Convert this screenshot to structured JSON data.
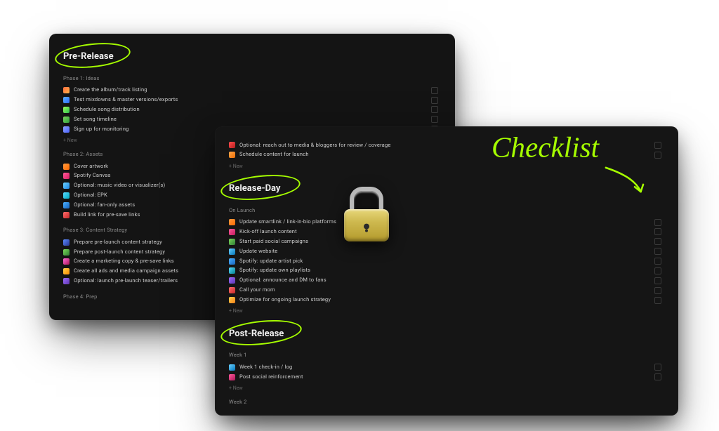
{
  "annotations": {
    "script_label": "Checklist"
  },
  "card_a": {
    "sections": [
      {
        "title": "Pre-Release",
        "subhead": "Phase 1: Ideas",
        "items": [
          {
            "icon": [
              "#ff6b3d",
              "#ffb347"
            ],
            "label": "Create the album/track listing"
          },
          {
            "icon": [
              "#5ab0ff",
              "#2d6bff"
            ],
            "label": "Test mixdowns & master versions/exports"
          },
          {
            "icon": [
              "#9bff5a",
              "#2dbf4e"
            ],
            "label": "Schedule song distribution"
          },
          {
            "icon": [
              "#7bd85a",
              "#2f9e3f"
            ],
            "label": "Set song timeline"
          },
          {
            "icon": [
              "#8fa2ff",
              "#4b63ff"
            ],
            "label": "Sign up for monitoring"
          }
        ],
        "new_label": "+ New"
      },
      {
        "subhead": "Phase 2: Assets",
        "items": [
          {
            "icon": [
              "#ff9a3d",
              "#ff6a00"
            ],
            "label": "Cover artwork"
          },
          {
            "icon": [
              "#ff5a9b",
              "#d81b60"
            ],
            "label": "Spotify Canvas"
          },
          {
            "icon": [
              "#6bd1ff",
              "#1e88e5"
            ],
            "label": "Optional: music video or visualizer(s)"
          },
          {
            "icon": [
              "#5ad8ff",
              "#00acc1"
            ],
            "label": "Optional: EPK"
          },
          {
            "icon": [
              "#4ab0ff",
              "#1565c0"
            ],
            "label": "Optional: fan-only assets"
          },
          {
            "icon": [
              "#ff6b6b",
              "#c62828"
            ],
            "label": "Build link for pre-save links"
          }
        ]
      },
      {
        "subhead": "Phase 3: Content Strategy",
        "items": [
          {
            "icon": [
              "#5a8bff",
              "#283593"
            ],
            "label": "Prepare pre-launch content strategy"
          },
          {
            "icon": [
              "#7bd85a",
              "#2e7d32"
            ],
            "label": "Prepare post-launch content strategy"
          },
          {
            "icon": [
              "#ff6bd8",
              "#ad1457"
            ],
            "label": "Create a marketing copy & pre-save links"
          },
          {
            "icon": [
              "#ffd24a",
              "#fb8c00"
            ],
            "label": "Create all ads and media campaign assets"
          },
          {
            "icon": [
              "#9b6bff",
              "#5e35b1"
            ],
            "label": "Optional: launch pre-launch teaser/trailers"
          }
        ]
      },
      {
        "subhead": "Phase 4: Prep",
        "items": []
      }
    ]
  },
  "card_b": {
    "top_items": [
      {
        "icon": [
          "#ff4d4d",
          "#b71c1c"
        ],
        "label": "Optional: reach out to media & bloggers for review / coverage"
      },
      {
        "icon": [
          "#ffa84d",
          "#ef6c00"
        ],
        "label": "Schedule content for launch"
      }
    ],
    "top_new": "+ New",
    "sections": [
      {
        "title": "Release-Day",
        "subhead": "On Launch",
        "items": [
          {
            "icon": [
              "#ff9a3d",
              "#ff6a00"
            ],
            "label": "Update smartlink / link-in-bio platforms"
          },
          {
            "icon": [
              "#ff5a9b",
              "#c2185b"
            ],
            "label": "Kick-off launch content"
          },
          {
            "icon": [
              "#7bd85a",
              "#2e7d32"
            ],
            "label": "Start paid social campaigns"
          },
          {
            "icon": [
              "#6bd1ff",
              "#0277bd"
            ],
            "label": "Update website"
          },
          {
            "icon": [
              "#4ab0ff",
              "#1565c0"
            ],
            "label": "Spotify: update artist pick"
          },
          {
            "icon": [
              "#5ad8ff",
              "#00838f"
            ],
            "label": "Spotify: update own playlists"
          },
          {
            "icon": [
              "#9b6bff",
              "#5e35b1"
            ],
            "label": "Optional: announce and DM to fans"
          },
          {
            "icon": [
              "#ff6b6b",
              "#c62828"
            ],
            "label": "Call your mom"
          },
          {
            "icon": [
              "#ffd24a",
              "#f57f17"
            ],
            "label": "Optimize for ongoing launch strategy"
          }
        ],
        "new_label": "+ New"
      },
      {
        "title": "Post-Release",
        "subhead": "Week 1",
        "items": [
          {
            "icon": [
              "#6bd1ff",
              "#0277bd"
            ],
            "label": "Week 1 check-in / log"
          },
          {
            "icon": [
              "#ff5a9b",
              "#ad1457"
            ],
            "label": "Post social reinforcement"
          }
        ],
        "new_label": "+ New"
      },
      {
        "subhead2": "Week 2"
      }
    ]
  }
}
